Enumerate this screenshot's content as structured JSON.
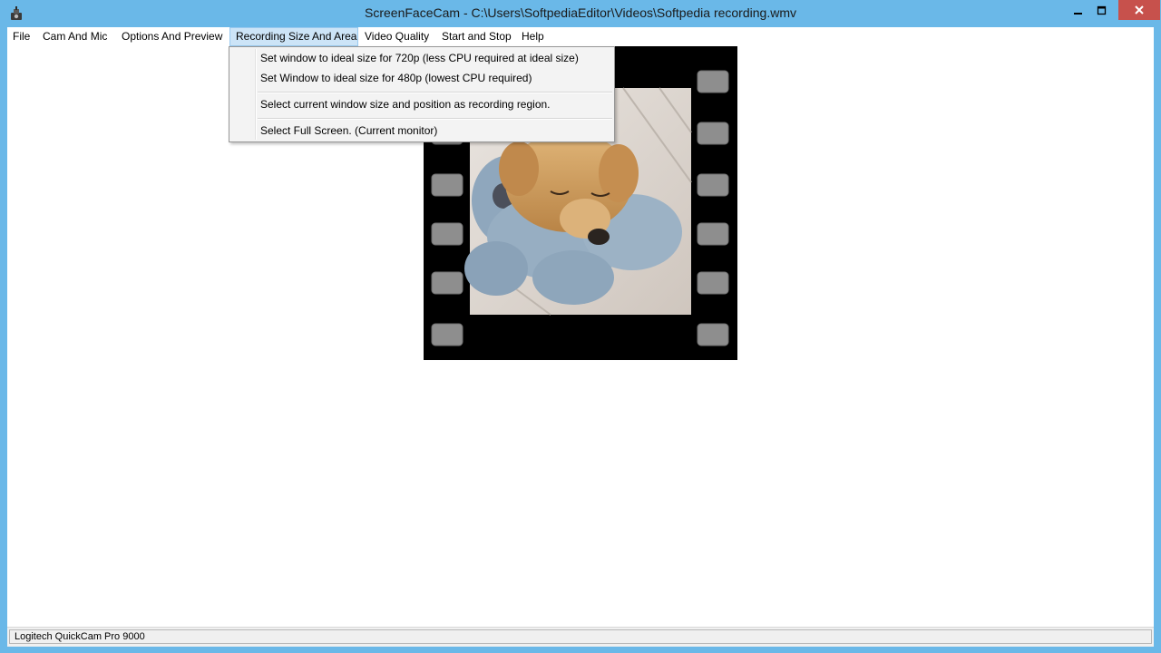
{
  "window": {
    "title": "ScreenFaceCam - C:\\Users\\SoftpediaEditor\\Videos\\Softpedia recording.wmv",
    "icon": "app-camera-icon"
  },
  "caption_buttons": {
    "minimize_icon": "minimize-icon",
    "maximize_icon": "maximize-icon",
    "close_icon": "close-icon",
    "close_color": "#c7514c"
  },
  "menubar": {
    "items": [
      {
        "label": "File"
      },
      {
        "label": "Cam And Mic"
      },
      {
        "label": "Options And Preview"
      },
      {
        "label": "Recording Size And Area"
      },
      {
        "label": "Video Quality"
      },
      {
        "label": "Start and Stop"
      },
      {
        "label": "Help"
      }
    ],
    "active_index": 3
  },
  "dropdown": {
    "items": [
      {
        "label": "Set window to ideal size for 720p (less CPU required at ideal size)"
      },
      {
        "label": "Set Window to ideal size for 480p (lowest CPU required)"
      },
      {
        "label": "Select current window size and position as recording region."
      },
      {
        "label": "Select Full Screen. (Current monitor)"
      }
    ]
  },
  "preview": {
    "frame": "film-strip-frame",
    "image": "sleeping-puppy-photo"
  },
  "statusbar": {
    "device": "Logitech QuickCam Pro 9000"
  },
  "colors": {
    "titlebar": "#6ab8e8",
    "menu_highlight": "#cce4f7"
  }
}
